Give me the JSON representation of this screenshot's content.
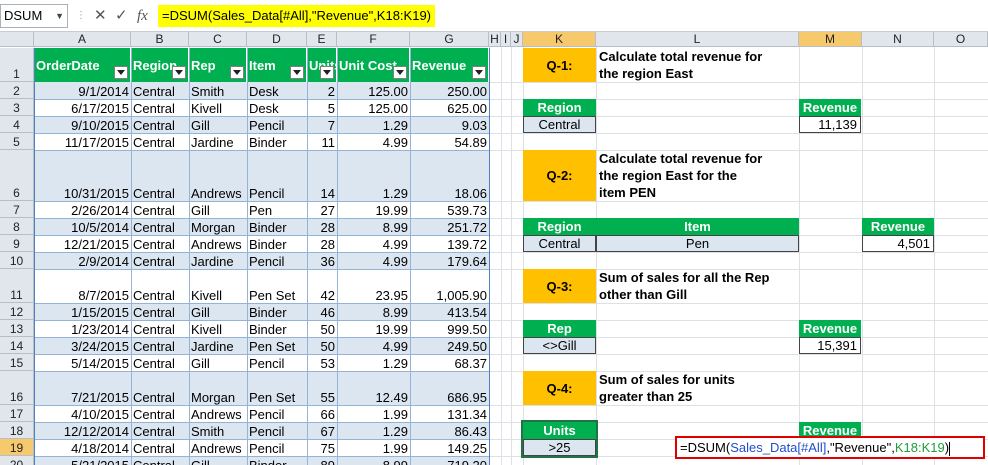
{
  "formula_bar": {
    "name_box": "DSUM",
    "cancel_icon": "✕",
    "enter_icon": "✓",
    "fx_label": "fx",
    "formula": "=DSUM(Sales_Data[#All],\"Revenue\",K18:K19)"
  },
  "columns": [
    "A",
    "B",
    "C",
    "D",
    "E",
    "F",
    "G",
    "H",
    "I",
    "J",
    "K",
    "L",
    "M",
    "N",
    "O"
  ],
  "table": {
    "headers": [
      "OrderDate",
      "Region",
      "Rep",
      "Item",
      "Units",
      "Unit Cost",
      "Revenue"
    ],
    "rows": [
      {
        "n": "2",
        "cells": [
          "9/1/2014",
          "Central",
          "Smith",
          "Desk",
          "2",
          "125.00",
          "250.00"
        ]
      },
      {
        "n": "3",
        "cells": [
          "6/17/2015",
          "Central",
          "Kivell",
          "Desk",
          "5",
          "125.00",
          "625.00"
        ]
      },
      {
        "n": "4",
        "cells": [
          "9/10/2015",
          "Central",
          "Gill",
          "Pencil",
          "7",
          "1.29",
          "9.03"
        ]
      },
      {
        "n": "5",
        "cells": [
          "11/17/2015",
          "Central",
          "Jardine",
          "Binder",
          "11",
          "4.99",
          "54.89"
        ]
      },
      {
        "n": "6",
        "cells": [
          "10/31/2015",
          "Central",
          "Andrews",
          "Pencil",
          "14",
          "1.29",
          "18.06"
        ]
      },
      {
        "n": "7",
        "cells": [
          "2/26/2014",
          "Central",
          "Gill",
          "Pen",
          "27",
          "19.99",
          "539.73"
        ]
      },
      {
        "n": "8",
        "cells": [
          "10/5/2014",
          "Central",
          "Morgan",
          "Binder",
          "28",
          "8.99",
          "251.72"
        ]
      },
      {
        "n": "9",
        "cells": [
          "12/21/2015",
          "Central",
          "Andrews",
          "Binder",
          "28",
          "4.99",
          "139.72"
        ]
      },
      {
        "n": "10",
        "cells": [
          "2/9/2014",
          "Central",
          "Jardine",
          "Pencil",
          "36",
          "4.99",
          "179.64"
        ]
      },
      {
        "n": "11",
        "cells": [
          "8/7/2015",
          "Central",
          "Kivell",
          "Pen Set",
          "42",
          "23.95",
          "1,005.90"
        ]
      },
      {
        "n": "12",
        "cells": [
          "1/15/2015",
          "Central",
          "Gill",
          "Binder",
          "46",
          "8.99",
          "413.54"
        ]
      },
      {
        "n": "13",
        "cells": [
          "1/23/2014",
          "Central",
          "Kivell",
          "Binder",
          "50",
          "19.99",
          "999.50"
        ]
      },
      {
        "n": "14",
        "cells": [
          "3/24/2015",
          "Central",
          "Jardine",
          "Pen Set",
          "50",
          "4.99",
          "249.50"
        ]
      },
      {
        "n": "15",
        "cells": [
          "5/14/2015",
          "Central",
          "Gill",
          "Pencil",
          "53",
          "1.29",
          "68.37"
        ]
      },
      {
        "n": "16",
        "cells": [
          "7/21/2015",
          "Central",
          "Morgan",
          "Pen Set",
          "55",
          "12.49",
          "686.95"
        ]
      },
      {
        "n": "17",
        "cells": [
          "4/10/2015",
          "Central",
          "Andrews",
          "Pencil",
          "66",
          "1.99",
          "131.34"
        ]
      },
      {
        "n": "18",
        "cells": [
          "12/12/2014",
          "Central",
          "Smith",
          "Pencil",
          "67",
          "1.29",
          "86.43"
        ]
      },
      {
        "n": "19",
        "cells": [
          "4/18/2014",
          "Central",
          "Andrews",
          "Pencil",
          "75",
          "1.99",
          "149.25"
        ]
      },
      {
        "n": "20",
        "cells": [
          "5/21/2015",
          "Central",
          "Gill",
          "Binder",
          "89",
          "8.99",
          "719.20"
        ]
      }
    ]
  },
  "row1": "1",
  "questions": {
    "q1": {
      "label": "Q-1:",
      "text_line1": "Calculate total revenue for",
      "text_line2": "the region East",
      "crit_header": "Region",
      "crit_value": "Central",
      "rev_header": "Revenue",
      "rev_value": "11,139"
    },
    "q2": {
      "label": "Q-2:",
      "text_line1": "Calculate total revenue for",
      "text_line2": "the region East for the",
      "text_line3": "item PEN",
      "crit_header": "Region",
      "crit_value": "Central",
      "item_header": "Item",
      "item_value": "Pen",
      "rev_header": "Revenue",
      "rev_value": "4,501"
    },
    "q3": {
      "label": "Q-3:",
      "text_line1": "Sum of sales for all the Rep",
      "text_line2": "other than Gill",
      "crit_header": "Rep",
      "crit_value": "<>Gill",
      "rev_header": "Revenue",
      "rev_value": "15,391"
    },
    "q4": {
      "label": "Q-4:",
      "text_line1": "Sum of sales for units",
      "text_line2": "greater than 25",
      "crit_header": "Units",
      "crit_value": ">25",
      "rev_header": "Revenue"
    }
  },
  "edit_formula": {
    "prefix": "=DSUM(",
    "range1": "Sales_Data[#All]",
    "middle": ",\"Revenue\",",
    "range2": "K18:K19",
    "suffix": ")"
  },
  "colors": {
    "table_header": "#00b050",
    "question": "#ffc000",
    "band": "#dce6f1",
    "formula_highlight": "#ffff00",
    "edit_border": "#e00000"
  }
}
